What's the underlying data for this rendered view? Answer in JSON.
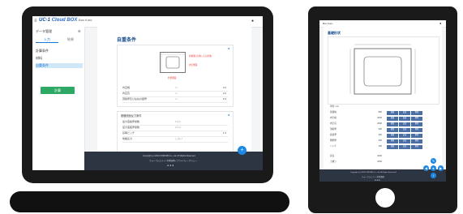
{
  "laptop": {
    "brand": "UC-1",
    "brand_suffix": "Cloud BOX",
    "app_name": "Box Kuro",
    "sidebar": {
      "title": "データ管理",
      "tabs": [
        "入力",
        "結果"
      ],
      "items": [
        {
          "label": "計算条件",
          "active": false
        },
        {
          "label": "材料",
          "active": false
        },
        {
          "label": "自重条件",
          "active": true
        }
      ],
      "action_label": "計算"
    },
    "panel": {
      "title": "自重条件",
      "diagram_labels": [
        "荷重図 (自重による荷重)",
        "内空断面",
        "外部断面"
      ],
      "fields": [
        {
          "label": "内空幅",
          "mid": "m",
          "value": "2.0"
        },
        {
          "label": "内空高",
          "mid": "m",
          "value": "2.0"
        },
        {
          "label": "頂版厚及び左右の壁厚",
          "mid": "m",
          "value": "0.3"
        }
      ],
      "section2_title": "基礎底面反力条件",
      "fields2": [
        {
          "label": "最大底板厚係数",
          "value": "0.4.0"
        },
        {
          "label": "最大底板厚係数",
          "value": "2.0.2"
        },
        {
          "label": "基準ピッチ",
          "value": "1.5"
        },
        {
          "label": "地盤反力",
          "value": "しない"
        }
      ]
    },
    "footer": {
      "copyright": "Copyright (c) 2024 FORUM8 Co., Ltd. All Rights Reserved.",
      "links": "フォーラムエイト | 利用規約 | プライバシーポリシー"
    }
  },
  "tablet": {
    "title": "Box Kuro",
    "panel_title": "基礎形状",
    "rows": [
      {
        "label": "単位: mm",
        "value": ""
      },
      {
        "label": "基礎幅",
        "value": "800"
      },
      {
        "label": "内空幅",
        "value": "2000"
      },
      {
        "label": "内空高",
        "value": "2000"
      },
      {
        "label": "頂版厚",
        "value": "300"
      },
      {
        "label": "底版厚",
        "value": "300"
      },
      {
        "label": "側壁厚",
        "value": "300"
      },
      {
        "label": "ハンチ",
        "value": "150"
      },
      {
        "label": "延長",
        "value": "1000"
      },
      {
        "label": "土被り",
        "value": "1000"
      }
    ],
    "cell_labels": [
      "編集",
      "追加",
      "削除"
    ],
    "footer": {
      "copyright": "Copyright (c) 2024 FORUM8 Co., Ltd. All Rights Reserved.",
      "links": "フォーラムエイト | 利用規約"
    }
  }
}
